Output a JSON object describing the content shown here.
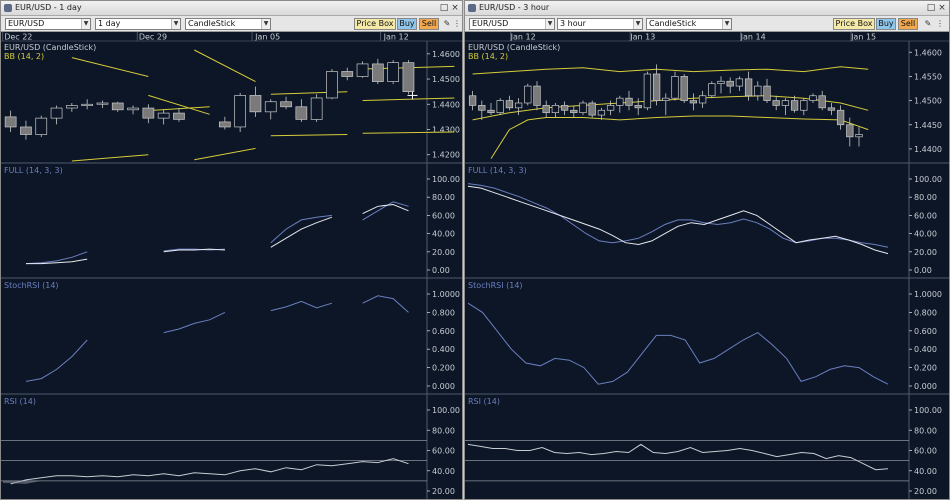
{
  "colors": {
    "background": "#0c1626",
    "axis_text": "#c8ccd4",
    "date_text": "#c8ccd4",
    "bb_line": "#d7cc3a",
    "candle_up": "#0c1626",
    "candle_down": "#7a7a7a",
    "candle_edge": "#c8c8c8",
    "oscillator_main": "#e6e8ee",
    "oscillator_signal": "#6b7fc0",
    "rsi_line": "#c8ccd4",
    "level_line": "#8a8f99",
    "price_label": "#c8ccd4",
    "bb_label": "#d7cc3a",
    "indicator_label": "#6b7fc0"
  },
  "windows": [
    {
      "title": "EUR/USD - 1 day",
      "symbol": "EUR/USD",
      "interval": "1 day",
      "chart_type": "CandleStick",
      "price_box": "Price Box",
      "buy": "Buy",
      "sell": "Sell",
      "price_label": "EUR/USD (CandleStick)",
      "bb_label": "BB (14, 2)",
      "full_label": "FULL (14, 3, 3)",
      "stochrsi_label": "StochRSI (14)",
      "rsi_label": "RSI (14)",
      "dates": [
        "Dec 22",
        "Dec 29",
        "Jan 05",
        "Jan 12"
      ],
      "price_ticks": [
        "1.4600",
        "1.4500",
        "1.4400",
        "1.4300",
        "1.4200"
      ],
      "full_ticks": [
        "100.00",
        "80.00",
        "60.00",
        "40.00",
        "20.00",
        "0.00"
      ],
      "stochrsi_ticks": [
        "1.0000",
        "0.800",
        "0.600",
        "0.400",
        "0.200",
        "0.000"
      ],
      "rsi_ticks": [
        "100.00",
        "80.00",
        "60.00",
        "40.00",
        "20.00"
      ]
    },
    {
      "title": "EUR/USD - 3 hour",
      "symbol": "EUR/USD",
      "interval": "3 hour",
      "chart_type": "CandleStick",
      "price_box": "Price Box",
      "buy": "Buy",
      "sell": "Sell",
      "price_label": "EUR/USD (CandleStick)",
      "bb_label": "BB (14, 2)",
      "full_label": "FULL (14, 3, 3)",
      "stochrsi_label": "StochRSI (14)",
      "rsi_label": "RSI (14)",
      "dates": [
        "Jan 12",
        "Jan 13",
        "Jan 14",
        "Jan 15"
      ],
      "price_ticks": [
        "1.4600",
        "1.4550",
        "1.4500",
        "1.4450",
        "1.4400"
      ],
      "full_ticks": [
        "100.00",
        "80.00",
        "60.00",
        "40.00",
        "20.00",
        "0.00"
      ],
      "stochrsi_ticks": [
        "1.0000",
        "0.800",
        "0.600",
        "0.400",
        "0.200",
        "0.000"
      ],
      "rsi_ticks": [
        "100.00",
        "80.00",
        "60.00",
        "40.00",
        "20.00"
      ]
    }
  ],
  "chart_data": [
    {
      "type": "candlestick",
      "title": "EUR/USD - 1 day",
      "ylim": [
        1.4175,
        1.4635
      ],
      "x_dates": [
        "Dec 22",
        "Dec 29",
        "Jan 05",
        "Jan 12"
      ],
      "x_date_index": [
        0.5,
        9.3,
        16.8,
        25.2
      ],
      "n": 27,
      "candles": [
        [
          1.435,
          1.4375,
          1.429,
          1.431
        ],
        [
          1.431,
          1.4335,
          1.426,
          1.428
        ],
        [
          1.428,
          1.4355,
          1.427,
          1.4345
        ],
        [
          1.4345,
          1.4395,
          1.432,
          1.4385
        ],
        [
          1.4385,
          1.4405,
          1.437,
          1.4395
        ],
        [
          1.4395,
          1.442,
          1.438,
          1.44
        ],
        [
          1.44,
          1.4415,
          1.4385,
          1.4405
        ],
        [
          1.4405,
          1.441,
          1.437,
          1.4378
        ],
        [
          1.4378,
          1.4395,
          1.436,
          1.4385
        ],
        [
          1.4385,
          1.44,
          1.4325,
          1.4345
        ],
        [
          1.4345,
          1.438,
          1.432,
          1.4365
        ],
        [
          1.4365,
          1.4385,
          1.433,
          1.434
        ],
        [
          null,
          null,
          null,
          null
        ],
        [
          null,
          null,
          null,
          null
        ],
        [
          1.433,
          1.435,
          1.43,
          1.431
        ],
        [
          1.431,
          1.4445,
          1.429,
          1.4435
        ],
        [
          1.4435,
          1.447,
          1.435,
          1.437
        ],
        [
          1.437,
          1.442,
          1.434,
          1.441
        ],
        [
          1.441,
          1.443,
          1.438,
          1.439
        ],
        [
          1.439,
          1.442,
          1.433,
          1.434
        ],
        [
          1.434,
          1.444,
          1.433,
          1.4425
        ],
        [
          1.4425,
          1.454,
          1.442,
          1.453
        ],
        [
          1.453,
          1.4545,
          1.4495,
          1.451
        ],
        [
          1.451,
          1.457,
          1.4505,
          1.456
        ],
        [
          1.456,
          1.458,
          1.448,
          1.449
        ],
        [
          1.449,
          1.4575,
          1.448,
          1.4565
        ],
        [
          1.4565,
          1.4575,
          1.444,
          1.445
        ]
      ],
      "bb_segments": [
        {
          "upper": [
            [
              4,
              1.4585
            ],
            [
              9,
              1.451
            ]
          ],
          "lower": [
            [
              4,
              1.4175
            ],
            [
              9,
              1.42
            ]
          ]
        },
        {
          "upper": [
            [
              9,
              1.4435
            ],
            [
              13,
              1.436
            ]
          ],
          "lower": [
            [
              9,
              1.4375
            ],
            [
              13,
              1.439
            ]
          ]
        },
        {
          "upper": [
            [
              12,
              1.4615
            ],
            [
              16,
              1.449
            ]
          ],
          "lower": [
            [
              12,
              1.418
            ],
            [
              16,
              1.4225
            ]
          ]
        },
        {
          "upper": [
            [
              17,
              1.444
            ],
            [
              22,
              1.445
            ]
          ],
          "lower": [
            [
              17,
              1.4275
            ],
            [
              22,
              1.428
            ]
          ]
        },
        {
          "upper": [
            [
              23,
              1.454
            ],
            [
              29,
              1.455
            ]
          ],
          "lower": [
            [
              23,
              1.4285
            ],
            [
              29,
              1.429
            ]
          ]
        },
        {
          "middle": [
            [
              23,
              1.4415
            ],
            [
              29,
              1.4425
            ]
          ]
        }
      ],
      "last_price_marker": 1.4435,
      "full_main": [
        [
          null
        ],
        [
          7
        ],
        [
          7
        ],
        [
          8
        ],
        [
          9
        ],
        [
          12
        ],
        [
          null
        ],
        [
          null
        ],
        [
          null
        ],
        [
          null
        ],
        [
          20
        ],
        [
          22
        ],
        [
          22
        ],
        [
          23
        ],
        [
          22
        ],
        [
          null
        ],
        [
          null
        ],
        [
          null
        ],
        [
          null
        ],
        [
          null
        ],
        [
          null
        ],
        [
          null
        ],
        [
          null
        ],
        [
          null
        ],
        [
          null
        ],
        [
          null
        ],
        [
          null
        ]
      ],
      "full_main_values": [
        null,
        7,
        7,
        8,
        9,
        12,
        null,
        null,
        null,
        null,
        20,
        22,
        22,
        23,
        22,
        null,
        null,
        25,
        35,
        45,
        52,
        58,
        null,
        62,
        70,
        72,
        65
      ],
      "full_signal_values": [
        null,
        7,
        8,
        10,
        14,
        20,
        null,
        null,
        null,
        null,
        21,
        23,
        23,
        22,
        23,
        null,
        null,
        30,
        45,
        55,
        58,
        60,
        null,
        55,
        65,
        75,
        70
      ],
      "stochrsi_values": [
        null,
        0.05,
        0.08,
        0.18,
        0.32,
        0.5,
        null,
        null,
        null,
        null,
        0.58,
        0.62,
        0.68,
        0.72,
        0.8,
        null,
        null,
        0.82,
        0.86,
        0.92,
        0.85,
        0.9,
        null,
        0.9,
        0.98,
        0.95,
        0.8
      ],
      "rsi_values": [
        27,
        31,
        33,
        35,
        35,
        34,
        35,
        34,
        36,
        35,
        37,
        35,
        38,
        37,
        36,
        40,
        42,
        39,
        43,
        41,
        46,
        45,
        47,
        49,
        48,
        52,
        47
      ],
      "rsi_levels": [
        70,
        50,
        30
      ]
    },
    {
      "type": "candlestick",
      "title": "EUR/USD - 3 hour",
      "ylim": [
        1.4375,
        1.4615
      ],
      "x_dates": [
        "Jan 12",
        "Jan 13",
        "Jan 14",
        "Jan 15"
      ],
      "x_date_index": [
        5.5,
        18.5,
        30.5,
        42.5
      ],
      "n": 45,
      "candles": [
        [
          1.451,
          1.452,
          1.448,
          1.449
        ],
        [
          1.449,
          1.45,
          1.446,
          1.448
        ],
        [
          1.448,
          1.4495,
          1.447,
          1.4475
        ],
        [
          1.4475,
          1.4505,
          1.447,
          1.45
        ],
        [
          1.45,
          1.451,
          1.448,
          1.4485
        ],
        [
          1.4485,
          1.4505,
          1.447,
          1.4495
        ],
        [
          1.4495,
          1.4535,
          1.449,
          1.453
        ],
        [
          1.453,
          1.454,
          1.448,
          1.449
        ],
        [
          1.449,
          1.45,
          1.4465,
          1.4475
        ],
        [
          1.4475,
          1.4495,
          1.4465,
          1.449
        ],
        [
          1.449,
          1.4498,
          1.447,
          1.448
        ],
        [
          1.448,
          1.449,
          1.4465,
          1.4475
        ],
        [
          1.4475,
          1.45,
          1.447,
          1.4495
        ],
        [
          1.4495,
          1.45,
          1.4465,
          1.447
        ],
        [
          1.447,
          1.4485,
          1.446,
          1.448
        ],
        [
          1.448,
          1.45,
          1.447,
          1.449
        ],
        [
          1.449,
          1.451,
          1.4475,
          1.4505
        ],
        [
          1.4505,
          1.452,
          1.448,
          1.449
        ],
        [
          1.449,
          1.4505,
          1.447,
          1.4485
        ],
        [
          1.4485,
          1.456,
          1.448,
          1.4555
        ],
        [
          1.4555,
          1.4575,
          1.449,
          1.45
        ],
        [
          1.45,
          1.4515,
          1.447,
          1.4505
        ],
        [
          1.4505,
          1.456,
          1.45,
          1.455
        ],
        [
          1.455,
          1.4555,
          1.4495,
          1.45
        ],
        [
          1.45,
          1.4515,
          1.448,
          1.4495
        ],
        [
          1.4495,
          1.452,
          1.4485,
          1.451
        ],
        [
          1.451,
          1.454,
          1.4505,
          1.4535
        ],
        [
          1.4535,
          1.455,
          1.4515,
          1.454
        ],
        [
          1.454,
          1.4548,
          1.4515,
          1.453
        ],
        [
          1.453,
          1.455,
          1.452,
          1.4545
        ],
        [
          1.4545,
          1.456,
          1.45,
          1.451
        ],
        [
          1.451,
          1.454,
          1.45,
          1.453
        ],
        [
          1.453,
          1.4545,
          1.4495,
          1.45
        ],
        [
          1.45,
          1.451,
          1.448,
          1.449
        ],
        [
          1.449,
          1.4505,
          1.447,
          1.45
        ],
        [
          1.45,
          1.451,
          1.4475,
          1.448
        ],
        [
          1.448,
          1.4505,
          1.447,
          1.45
        ],
        [
          1.45,
          1.4515,
          1.4495,
          1.451
        ],
        [
          1.451,
          1.452,
          1.448,
          1.4485
        ],
        [
          1.4485,
          1.4495,
          1.447,
          1.448
        ],
        [
          1.448,
          1.449,
          1.444,
          1.445
        ],
        [
          1.445,
          1.4465,
          1.4405,
          1.4425
        ],
        [
          1.4425,
          1.4445,
          1.4405,
          1.443
        ],
        [
          null,
          null,
          null,
          null
        ],
        [
          null,
          null,
          null,
          null
        ]
      ],
      "bb_upper": [
        [
          0,
          1.4555
        ],
        [
          4,
          1.456
        ],
        [
          8,
          1.4565
        ],
        [
          12,
          1.4568
        ],
        [
          16,
          1.456
        ],
        [
          20,
          1.4565
        ],
        [
          24,
          1.456
        ],
        [
          28,
          1.4563
        ],
        [
          32,
          1.4565
        ],
        [
          36,
          1.456
        ],
        [
          40,
          1.457
        ],
        [
          43,
          1.4565
        ]
      ],
      "bb_middle": [
        [
          0,
          1.446
        ],
        [
          4,
          1.4475
        ],
        [
          8,
          1.4485
        ],
        [
          12,
          1.449
        ],
        [
          16,
          1.4495
        ],
        [
          20,
          1.45
        ],
        [
          24,
          1.4505
        ],
        [
          28,
          1.4508
        ],
        [
          32,
          1.451
        ],
        [
          36,
          1.4505
        ],
        [
          40,
          1.4495
        ],
        [
          43,
          1.448
        ]
      ],
      "bb_lower": [
        [
          2,
          1.438
        ],
        [
          4,
          1.444
        ],
        [
          6,
          1.446
        ],
        [
          8,
          1.4465
        ],
        [
          12,
          1.4465
        ],
        [
          16,
          1.446
        ],
        [
          20,
          1.4465
        ],
        [
          24,
          1.4468
        ],
        [
          28,
          1.4468
        ],
        [
          32,
          1.4465
        ],
        [
          36,
          1.4462
        ],
        [
          40,
          1.446
        ],
        [
          43,
          1.444
        ]
      ],
      "full_main_values": [
        92,
        90,
        85,
        80,
        75,
        70,
        65,
        60,
        55,
        50,
        45,
        38,
        30,
        28,
        32,
        40,
        48,
        52,
        50,
        55,
        60,
        65,
        60,
        50,
        40,
        30,
        33,
        35,
        37,
        33,
        28,
        22,
        18
      ],
      "full_signal_values": [
        95,
        93,
        90,
        85,
        80,
        74,
        68,
        60,
        50,
        40,
        32,
        30,
        32,
        35,
        42,
        50,
        55,
        55,
        52,
        50,
        52,
        56,
        52,
        45,
        35,
        30,
        32,
        35,
        35,
        33,
        30,
        28,
        25
      ],
      "stochrsi_values": [
        0.9,
        0.8,
        0.6,
        0.4,
        0.25,
        0.22,
        0.3,
        0.28,
        0.2,
        0.02,
        0.05,
        0.15,
        0.35,
        0.55,
        0.55,
        0.5,
        0.25,
        0.3,
        0.4,
        0.5,
        0.58,
        0.45,
        0.3,
        0.05,
        0.1,
        0.18,
        0.22,
        0.2,
        0.1,
        0.02
      ],
      "rsi_values": [
        66,
        64,
        62,
        62,
        60,
        60,
        63,
        58,
        57,
        58,
        56,
        57,
        59,
        58,
        66,
        58,
        57,
        59,
        63,
        58,
        59,
        60,
        62,
        60,
        57,
        54,
        56,
        58,
        57,
        52,
        55,
        53,
        47,
        41,
        42
      ],
      "rsi_levels": [
        70,
        50,
        30
      ]
    }
  ]
}
